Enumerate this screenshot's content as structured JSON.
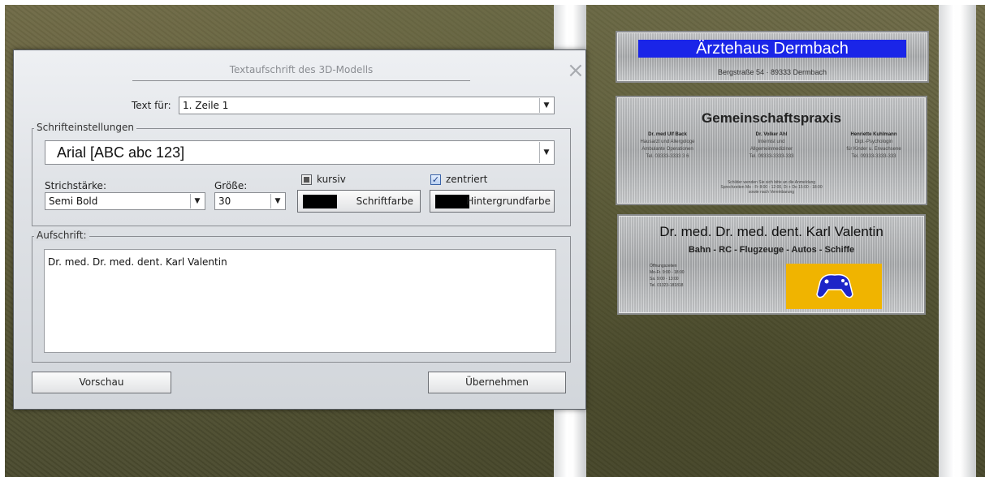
{
  "scene": {
    "plate1": {
      "title": "Ärztehaus Dermbach",
      "address": "Bergstraße 54 · 89333 Dermbach",
      "banner_color": "#1a25e8"
    },
    "plate2": {
      "title": "Gemeinschaftspraxis",
      "columns": [
        {
          "name": "Dr. med Ulf Back",
          "lines": [
            "Hausarzt und Allergologe",
            "Ambulante Operationen",
            "Tel. 03333-3333 3 6"
          ]
        },
        {
          "name": "Dr. Volker Ahl",
          "lines": [
            "Internist und",
            "Allgemeinmediziner",
            "Tel. 09333-3333-333"
          ]
        },
        {
          "name": "Henriette Kuhlmann",
          "lines": [
            "Dipl.-Psychologin",
            "für Kinder u. Erwachsene",
            "Tel. 09333-3333-333"
          ]
        }
      ],
      "footer": [
        "Schilder wenden Sie sich bitte an die Anmeldung",
        "Sprechzeiten Mo - Fr 8:00 - 12:00, Di + Do 15:00 - 18:00",
        "sowie nach Vereinbarung"
      ]
    },
    "plate3": {
      "title": "Dr. med. Dr. med. dent. Karl Valentin",
      "subtitle": "Bahn - RC - Flugzeuge - Autos - Schiffe",
      "hours": [
        "Öffnungszeiten",
        "Mo-Fr. 9:00 - 18:00",
        "Sa.      9:00 - 13:00",
        "Tel. 01323-181818"
      ],
      "image_color": "#f0b400"
    }
  },
  "dialog": {
    "title": "Textaufschrift des 3D-Modells",
    "close_icon": "×",
    "text_for_label": "Text für:",
    "text_for_value": "1. Zeile 1",
    "font_group_label": "Schrifteinstellungen",
    "font_value": "Arial  [ABC abc 123]",
    "stroke_label": "Strichstärke:",
    "stroke_value": "Semi Bold",
    "size_label": "Größe:",
    "size_value": "30",
    "italic_label": "kursiv",
    "italic_checked": false,
    "centered_label": "zentriert",
    "centered_checked": true,
    "font_color_label": "Schriftfarbe",
    "font_color": "#000000",
    "bg_color_label": "Hintergrundfarbe",
    "bg_color": "#000000",
    "inscription_group_label": "Aufschrift:",
    "inscription_text": "Dr. med. Dr. med. dent. Karl Valentin",
    "preview_button": "Vorschau",
    "apply_button": "Übernehmen",
    "dropdown_arrow": "▼",
    "check_mark": "✓"
  }
}
